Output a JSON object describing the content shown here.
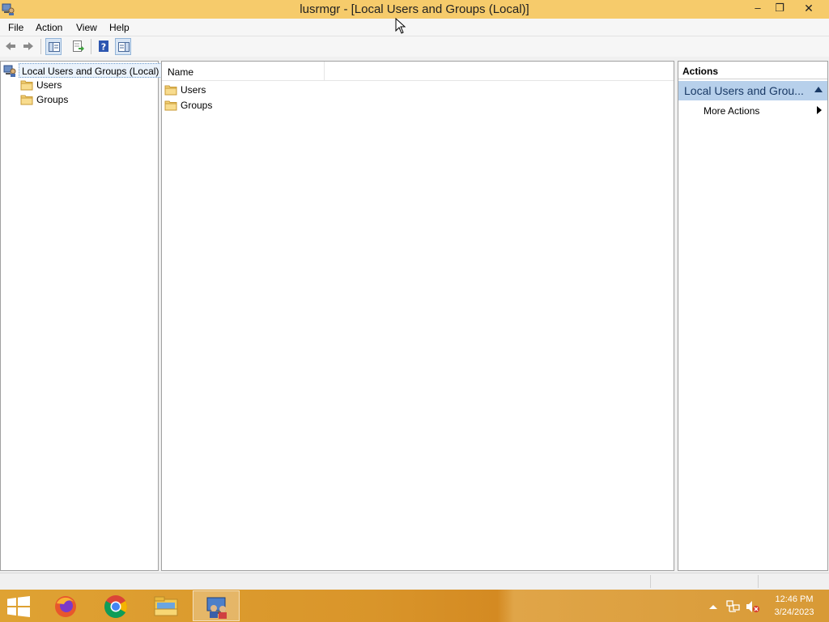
{
  "window": {
    "title": "lusrmgr - [Local Users and Groups (Local)]",
    "controls": {
      "minimize": "–",
      "maximize": "❐",
      "close": "✕"
    }
  },
  "menu": {
    "file": "File",
    "action": "Action",
    "view": "View",
    "help": "Help"
  },
  "toolbar": {
    "buttons": [
      "back-icon",
      "forward-icon",
      "show-hide-console-tree-icon",
      "export-list-icon",
      "help-icon",
      "show-hide-action-pane-icon"
    ]
  },
  "tree": {
    "root": "Local Users and Groups (Local)",
    "children": [
      "Users",
      "Groups"
    ]
  },
  "list": {
    "columns": [
      "Name"
    ],
    "rows": [
      "Users",
      "Groups"
    ]
  },
  "actions": {
    "header": "Actions",
    "section_title": "Local Users and Grou...",
    "items": [
      "More Actions"
    ]
  },
  "taskbar": {
    "apps": [
      "start-icon",
      "firefox-icon",
      "chrome-icon",
      "file-explorer-icon",
      "computer-management-icon"
    ],
    "time": "12:46 PM",
    "date": "3/24/2023"
  },
  "colors": {
    "title_bar": "#f6cb6b",
    "actions_section": "#b7d0eb",
    "taskbar": "#d9952a"
  }
}
